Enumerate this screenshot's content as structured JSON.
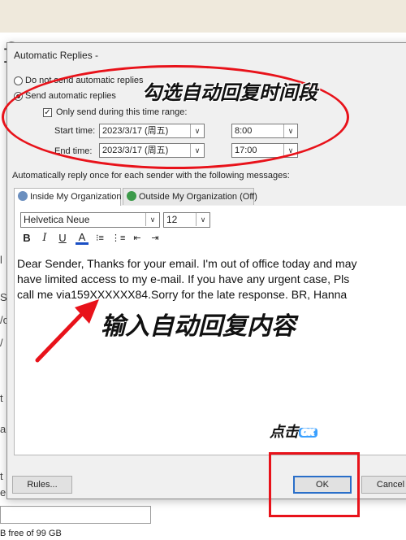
{
  "background": {
    "big_letter": "f",
    "edge_letters": [
      "l",
      "S",
      "/c",
      "/",
      "t",
      "a",
      "t",
      "e"
    ],
    "status_text": "B free of 99 GB"
  },
  "dialog": {
    "title": "Automatic Replies -",
    "radio_do_not_send": "Do not send automatic replies",
    "radio_send": "Send automatic replies",
    "check_time_range": "Only send during this time range:",
    "start_time_label": "Start time:",
    "start_date": "2023/3/17 (周五)",
    "start_time": "8:00",
    "end_time_label": "End time:",
    "end_date": "2023/3/17 (周五)",
    "end_time": "17:00",
    "reply_once_label": "Automatically reply once for each sender with the following messages:",
    "tabs": [
      {
        "label": "Inside My Organization",
        "active": true
      },
      {
        "label": "Outside My Organization (Off)",
        "active": false
      }
    ],
    "font_name": "Helvetica Neue",
    "font_size": "12",
    "format_buttons": [
      "B",
      "I",
      "U",
      "A",
      "bullets",
      "numbering",
      "decrease-indent",
      "increase-indent"
    ],
    "message_lines": [
      "Dear Sender, Thanks for your email. I'm out of office today and may",
      "have limited access to my e-mail. If you have any urgent case, Pls",
      "call me via159XXXXXX84.Sorry for the late response. BR, Hanna"
    ],
    "rules_button": "Rules...",
    "ok_button": "OK",
    "cancel_button": "Cancel"
  },
  "annotations": {
    "select_auto_reply_time": "勾选自动回复时间段",
    "enter_reply_content": "输入自动回复内容",
    "click_prefix": "点击",
    "click_ok_badge": "OK",
    "accent_color": "#e8121a"
  }
}
